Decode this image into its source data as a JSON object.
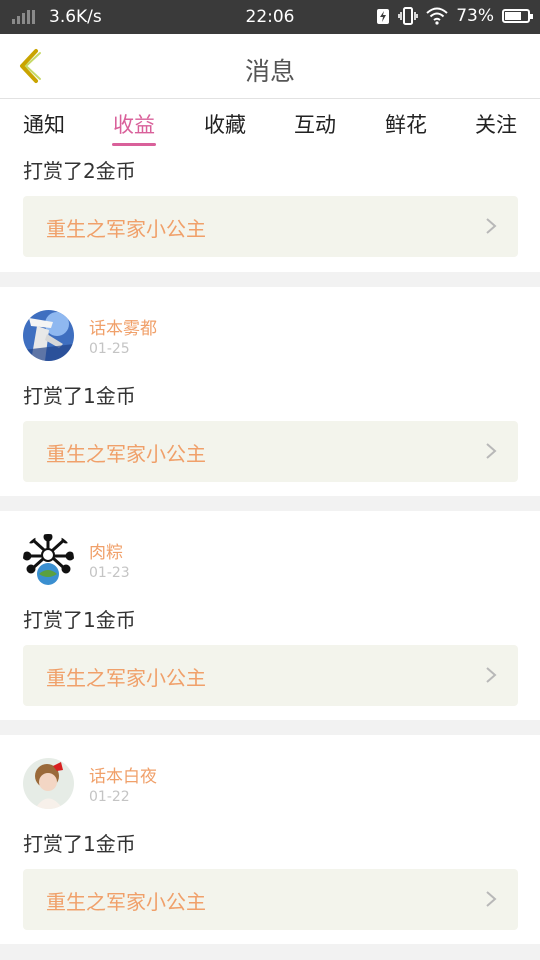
{
  "status_bar": {
    "speed": "3.6K/s",
    "time": "22:06",
    "battery": "73%",
    "battery_level": 0.73
  },
  "header": {
    "title": "消息",
    "back_icon": "chevron-left-icon"
  },
  "tabs": [
    {
      "label": "通知",
      "active": false
    },
    {
      "label": "收益",
      "active": true
    },
    {
      "label": "收藏",
      "active": false
    },
    {
      "label": "互动",
      "active": false
    },
    {
      "label": "鲜花",
      "active": false
    },
    {
      "label": "关注",
      "active": false
    }
  ],
  "messages": [
    {
      "user": "",
      "date": "",
      "action": "打赏了2金币",
      "book": "重生之军家小公主"
    },
    {
      "user": "话本雾都",
      "date": "01-25",
      "action": "打赏了1金币",
      "book": "重生之军家小公主"
    },
    {
      "user": "肉粽",
      "date": "01-23",
      "action": "打赏了1金币",
      "book": "重生之军家小公主"
    },
    {
      "user": "话本白夜",
      "date": "01-22",
      "action": "打赏了1金币",
      "book": "重生之军家小公主"
    }
  ],
  "colors": {
    "accent": "#d9609a",
    "username": "#f0a06a",
    "back_arrow": "#c9a400",
    "status_bar": "#3a3a3a"
  }
}
